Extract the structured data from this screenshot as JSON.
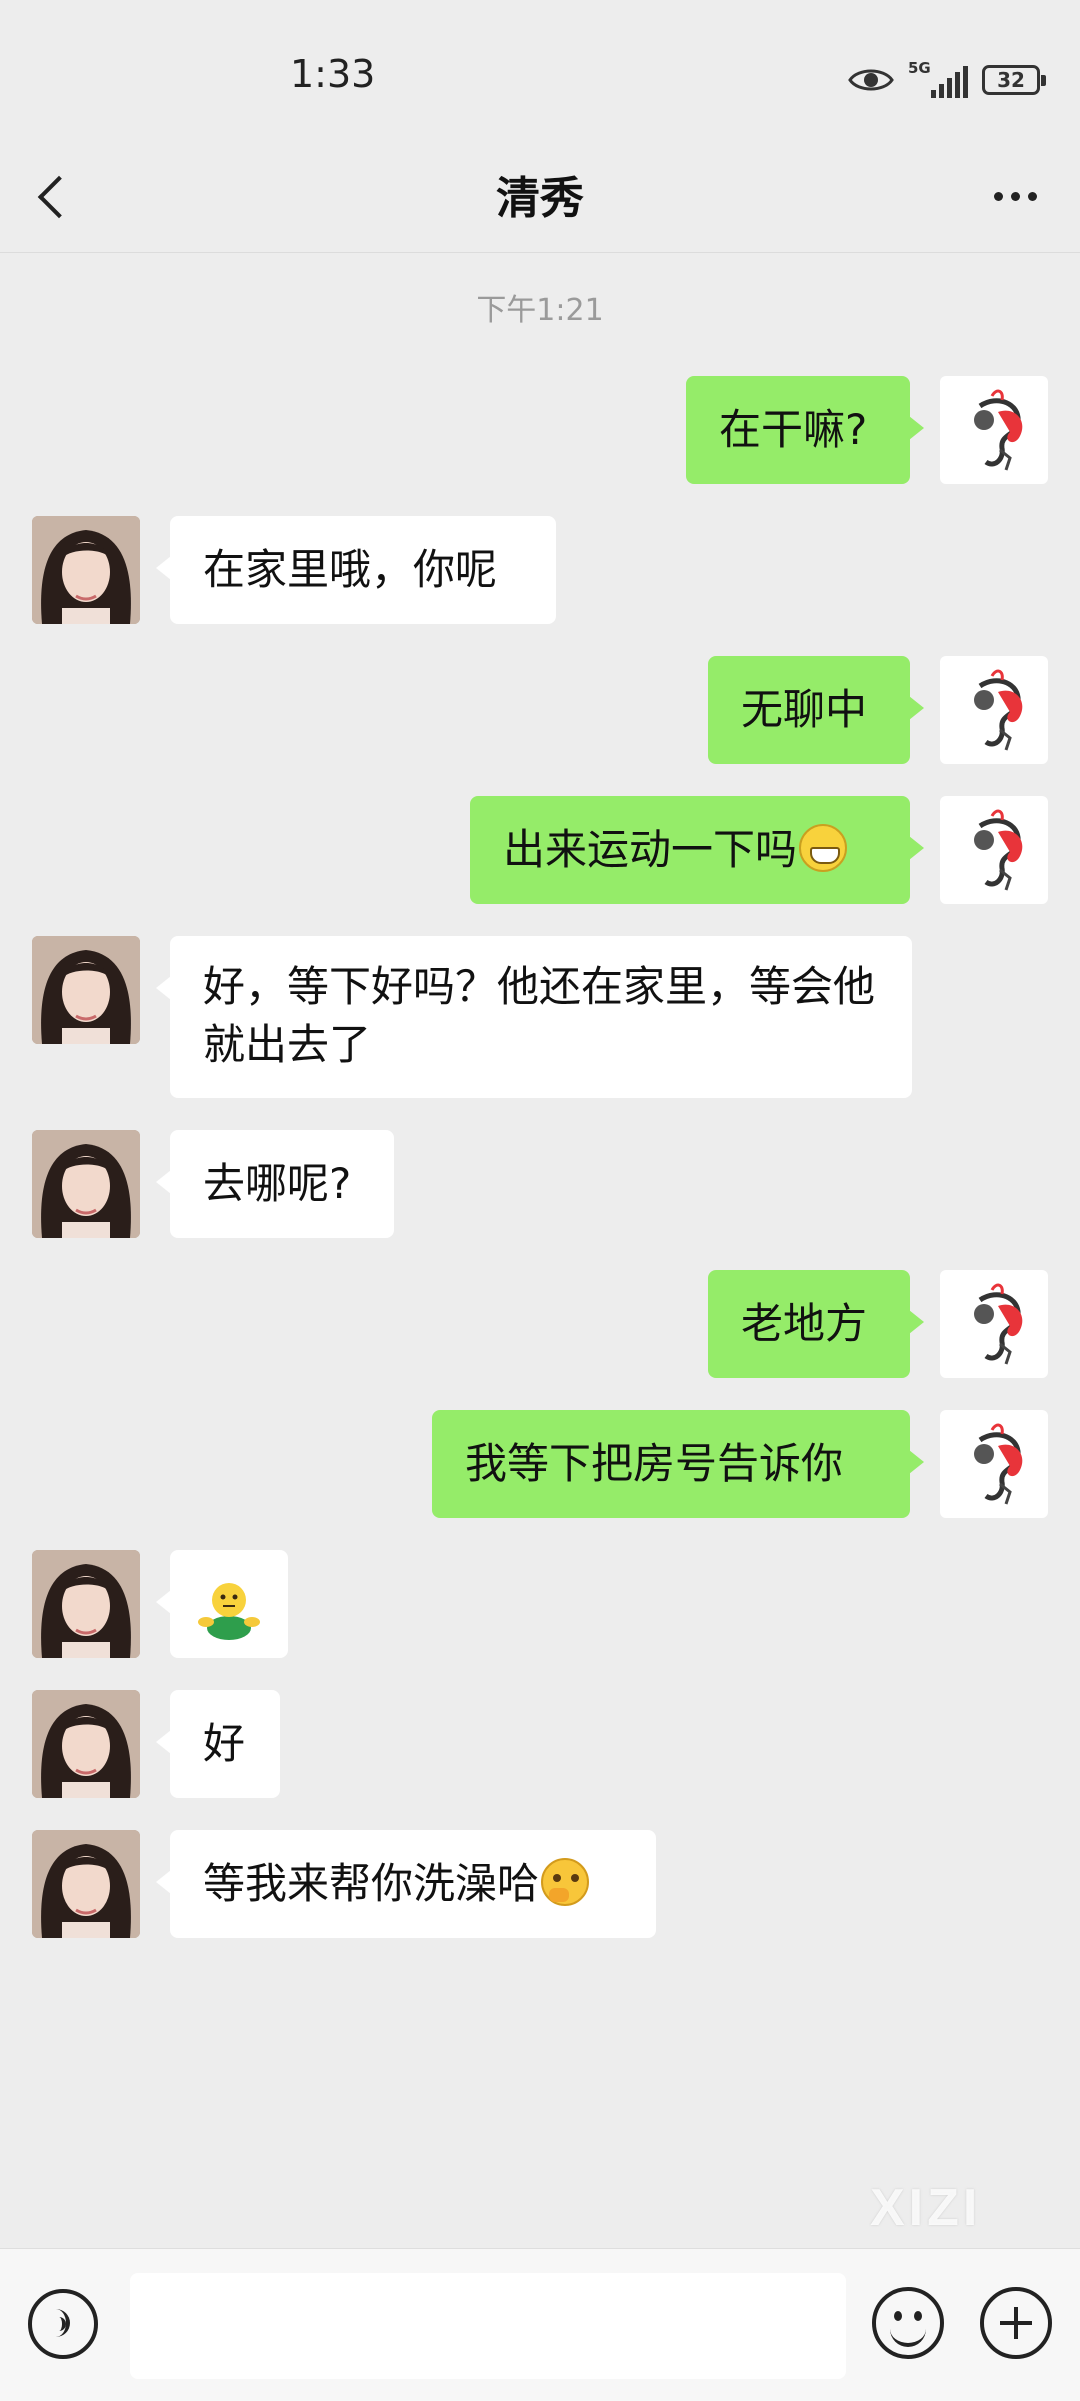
{
  "status_bar": {
    "time": "1:33",
    "network": "5G",
    "battery": "32"
  },
  "header": {
    "title": "清秀"
  },
  "chat": {
    "timestamp": "下午1:21",
    "messages": [
      {
        "sender": "me",
        "text": "在干嘛?"
      },
      {
        "sender": "her",
        "text": "在家里哦，你呢"
      },
      {
        "sender": "me",
        "text": "无聊中"
      },
      {
        "sender": "me",
        "text": "出来运动一下吗",
        "emoji": "grinning-emoji"
      },
      {
        "sender": "her",
        "text": "好，等下好吗？他还在家里，等会他就出去了"
      },
      {
        "sender": "her",
        "text": "去哪呢?"
      },
      {
        "sender": "me",
        "text": "老地方"
      },
      {
        "sender": "me",
        "text": "我等下把房号告诉你"
      },
      {
        "sender": "her",
        "text": "",
        "emoji": "hug-sticker"
      },
      {
        "sender": "her",
        "text": "好"
      },
      {
        "sender": "her",
        "text": "等我来帮你洗澡哈",
        "emoji": "thinking-emoji"
      }
    ]
  },
  "input_bar": {
    "placeholder": ""
  },
  "watermark": "XIZI",
  "colors": {
    "outgoing_bubble": "#95ec69",
    "incoming_bubble": "#ffffff",
    "background": "#ededed"
  }
}
